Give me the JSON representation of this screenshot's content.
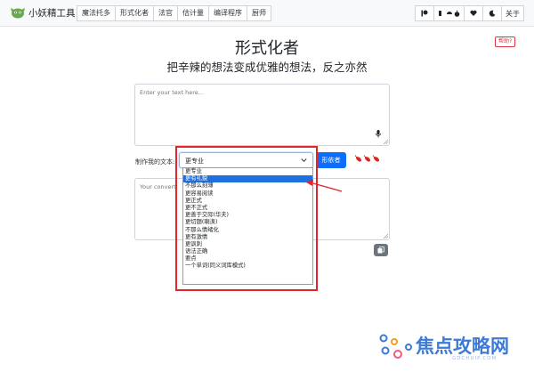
{
  "brand": {
    "name": "小妖精工具"
  },
  "nav": {
    "tabs": [
      "魔法托多",
      "形式化者",
      "法官",
      "估计量",
      "编译程序",
      "厨师"
    ],
    "about_label": "关于"
  },
  "help_label": "帮助?",
  "page": {
    "title": "形式化者",
    "subtitle": "把辛辣的想法变成优雅的想法，反之亦然"
  },
  "input": {
    "placeholder": "Enter your text here..."
  },
  "controls": {
    "make_label": "制作我的文本:",
    "selected": "更专业",
    "button_label": "形依者"
  },
  "dropdown": {
    "options": [
      "更专业",
      "更有礼貌",
      "不那么刻薄",
      "更容易阅读",
      "更正式",
      "更不正式",
      "更善于交际(华夫)",
      "更切题(喇涣)",
      "不那么情绪化",
      "更有激情",
      "更讽刺",
      "语法正确",
      "要点",
      "一个单词(同义词库模式)"
    ],
    "highlighted_index": 1
  },
  "output": {
    "placeholder": "Your convert"
  },
  "watermark": {
    "text": "焦点攻略网",
    "sub": "GDCHUIP.COM"
  },
  "colors": {
    "primary": "#0d6efd",
    "highlight": "#e0252b",
    "selected_option": "#1e6fe0"
  },
  "icons": [
    "monster-logo-icon",
    "patreon-icon",
    "android-icon",
    "apple-icon",
    "heart-icon",
    "moon-icon",
    "microphone-icon",
    "chevron-down-icon",
    "chili-pepper-icon",
    "copy-icon"
  ]
}
